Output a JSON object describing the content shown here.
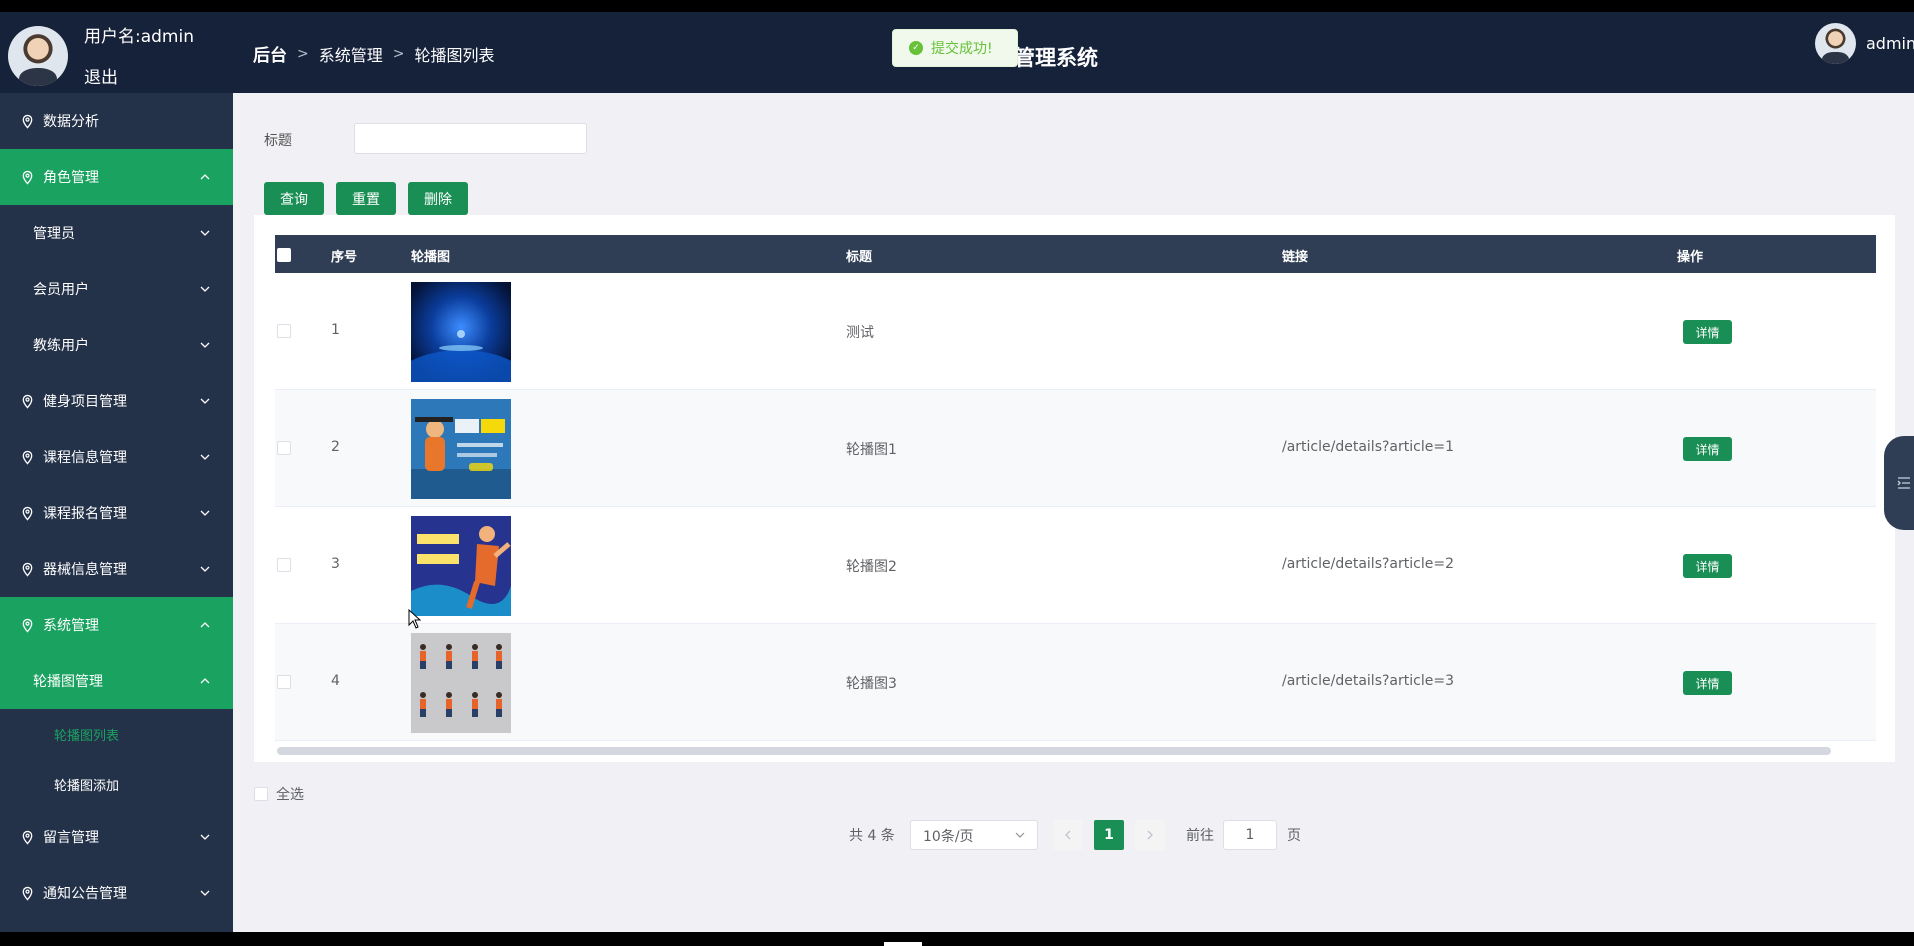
{
  "header": {
    "user_name": "用户名:admin",
    "logout": "退出",
    "breadcrumb": {
      "root": "后台",
      "level1": "系统管理",
      "level2": "轮播图列表"
    },
    "title": "管理系统",
    "toast": "提交成功!",
    "right_user": "admin"
  },
  "sidebar": {
    "data_analysis": "数据分析",
    "role_mgmt": "角色管理",
    "admin": "管理员",
    "member": "会员用户",
    "coach": "教练用户",
    "fitness": "健身项目管理",
    "course_info": "课程信息管理",
    "course_signup": "课程报名管理",
    "equipment": "器械信息管理",
    "system": "系统管理",
    "carousel": "轮播图管理",
    "carousel_list": "轮播图列表",
    "carousel_add": "轮播图添加",
    "message": "留言管理",
    "notice": "通知公告管理"
  },
  "search": {
    "label": "标题",
    "value": ""
  },
  "buttons": {
    "query": "查询",
    "reset": "重置",
    "delete": "删除"
  },
  "table": {
    "columns": [
      "序号",
      "轮播图",
      "标题",
      "链接",
      "操作"
    ],
    "rows": [
      {
        "num": "1",
        "title": "测试",
        "link": "",
        "action": "详情"
      },
      {
        "num": "2",
        "title": "轮播图1",
        "link": "/article/details?article=1",
        "action": "详情"
      },
      {
        "num": "3",
        "title": "轮播图2",
        "link": "/article/details?article=2",
        "action": "详情"
      },
      {
        "num": "4",
        "title": "轮播图3",
        "link": "/article/details?article=3",
        "action": "详情"
      }
    ]
  },
  "select_all": "全选",
  "pagination": {
    "total": "共 4 条",
    "page_size": "10条/页",
    "current": "1",
    "goto_label": "前往",
    "goto_value": "1",
    "unit": "页"
  },
  "colors": {
    "header": "#16213a",
    "sidebar": "#243249",
    "accent": "#1aa260",
    "button": "#1a8f55"
  }
}
